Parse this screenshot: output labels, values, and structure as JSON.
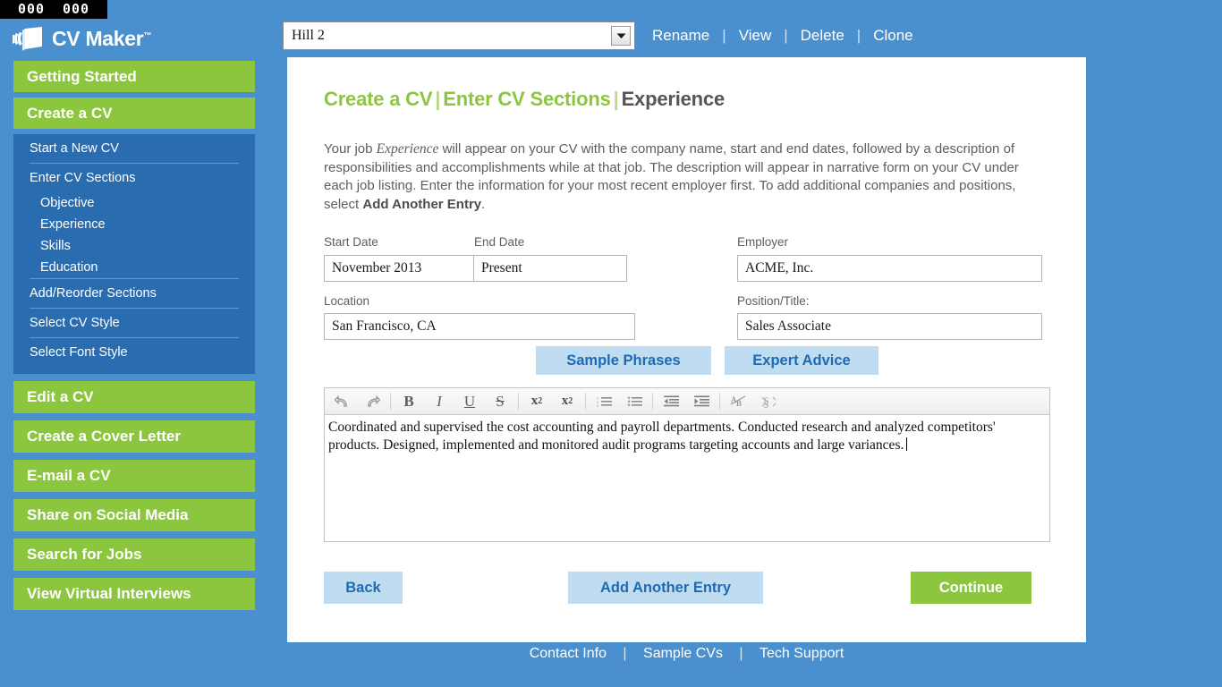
{
  "counter": {
    "left": "000",
    "right": "000"
  },
  "brand": {
    "name": "CV Maker",
    "tm": "™",
    "logo_icon": "stacked-pages-icon"
  },
  "sidebar": {
    "primary": [
      {
        "label": "Getting Started"
      },
      {
        "label": "Create a CV"
      }
    ],
    "submenu": [
      {
        "label": "Start a New CV",
        "type": "item"
      },
      {
        "label": "Enter CV Sections",
        "type": "item"
      },
      {
        "label": "Objective",
        "type": "child"
      },
      {
        "label": "Experience",
        "type": "child"
      },
      {
        "label": "Skills",
        "type": "child"
      },
      {
        "label": "Education",
        "type": "child"
      },
      {
        "label": "Add/Reorder Sections",
        "type": "item"
      },
      {
        "label": "Select CV Style",
        "type": "item"
      },
      {
        "label": "Select Font Style",
        "type": "item"
      }
    ],
    "lower": [
      {
        "label": "Edit a CV"
      },
      {
        "label": "Create a Cover Letter"
      },
      {
        "label": "E-mail a CV"
      },
      {
        "label": "Share on Social Media"
      },
      {
        "label": "Search for Jobs"
      },
      {
        "label": "View Virtual Interviews"
      }
    ]
  },
  "toolbar": {
    "cv_select_value": "Hill 2",
    "dropdown_icon": "chevron-down-icon",
    "links": [
      {
        "label": "Rename"
      },
      {
        "label": "View"
      },
      {
        "label": "Delete"
      },
      {
        "label": "Clone"
      }
    ],
    "separator": "|"
  },
  "main": {
    "breadcrumb": {
      "part1": "Create a CV",
      "part2": "Enter CV Sections",
      "current": "Experience",
      "sep": "|"
    },
    "intro": {
      "t1": "Your job ",
      "em": "Experience",
      "t2": " will appear on your CV with the company name, start and end dates, followed by a description of responsibilities and accomplishments while at that job. The description will appear in narrative form on your CV under each job listing. Enter the information for your most recent employer first. To add additional companies and positions, select ",
      "strong": "Add Another Entry",
      "t3": "."
    },
    "fields": {
      "start_date_label": "Start Date",
      "start_date_value": "November 2013",
      "end_date_label": "End Date",
      "end_date_value": "Present",
      "employer_label": "Employer",
      "employer_value": "ACME, Inc.",
      "location_label": "Location",
      "location_value": "San Francisco, CA",
      "position_label": "Position/Title:",
      "position_value": "Sales Associate"
    },
    "helper_buttons": [
      {
        "label": "Sample Phrases"
      },
      {
        "label": "Expert Advice"
      }
    ],
    "editor": {
      "tools": [
        {
          "name": "undo-icon",
          "glyph": "↶"
        },
        {
          "name": "redo-icon",
          "glyph": "↷"
        },
        {
          "name": "bold-icon",
          "glyph": "B"
        },
        {
          "name": "italic-icon",
          "glyph": "I"
        },
        {
          "name": "underline-icon",
          "glyph": "U"
        },
        {
          "name": "strikethrough-icon",
          "glyph": "S"
        },
        {
          "name": "subscript-icon",
          "glyph": "x"
        },
        {
          "name": "superscript-icon",
          "glyph": "x"
        },
        {
          "name": "numbered-list-icon",
          "glyph": "≡"
        },
        {
          "name": "bullet-list-icon",
          "glyph": "≡"
        },
        {
          "name": "outdent-icon",
          "glyph": "≡"
        },
        {
          "name": "indent-icon",
          "glyph": "≡"
        },
        {
          "name": "spellcheck-icon",
          "glyph": "A"
        },
        {
          "name": "special-characters-icon",
          "glyph": "§"
        }
      ],
      "content": "Coordinated and supervised the cost accounting and payroll departments. Conducted research and analyzed competitors' products. Designed, implemented and monitored audit programs targeting accounts and large variances."
    },
    "bottom_buttons": {
      "back": "Back",
      "add_another": "Add Another Entry",
      "continue": "Continue"
    }
  },
  "footer": {
    "links": [
      {
        "label": "Contact Info"
      },
      {
        "label": "Sample CVs"
      },
      {
        "label": "Tech Support"
      }
    ],
    "separator": "|"
  },
  "colors": {
    "page_blue": "#4a90cf",
    "brand_green": "#8cc63e",
    "submenu_blue": "#2a6cb0",
    "button_blue": "#c0dcf0",
    "button_blue_text": "#1d6bb5",
    "text_gray": "#5e5e5e"
  }
}
